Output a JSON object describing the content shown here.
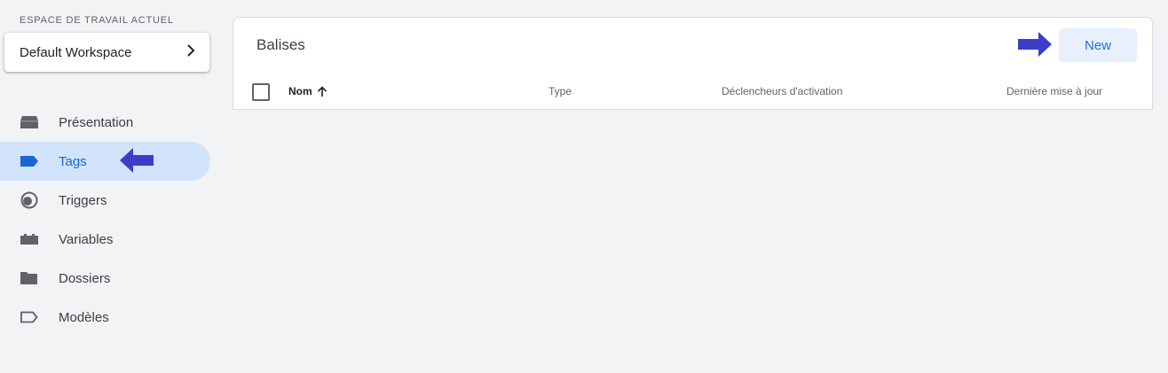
{
  "workspace": {
    "section_label": "ESPACE DE TRAVAIL ACTUEL",
    "name": "Default Workspace"
  },
  "sidebar": {
    "items": [
      {
        "label": "Présentation",
        "icon": "overview-icon"
      },
      {
        "label": "Tags",
        "icon": "tag-icon",
        "active": true
      },
      {
        "label": "Triggers",
        "icon": "trigger-icon"
      },
      {
        "label": "Variables",
        "icon": "variables-icon"
      },
      {
        "label": "Dossiers",
        "icon": "folder-icon"
      },
      {
        "label": "Modèles",
        "icon": "template-icon"
      }
    ]
  },
  "panel": {
    "title": "Balises",
    "new_button": "New",
    "columns": {
      "name": "Nom",
      "type": "Type",
      "triggers": "Déclencheurs d'activation",
      "updated": "Dernière mise à jour"
    }
  },
  "colors": {
    "accent": "#1a73e8",
    "active_bg": "#d2e3fc",
    "annotation_arrow": "#3d3dc9"
  }
}
